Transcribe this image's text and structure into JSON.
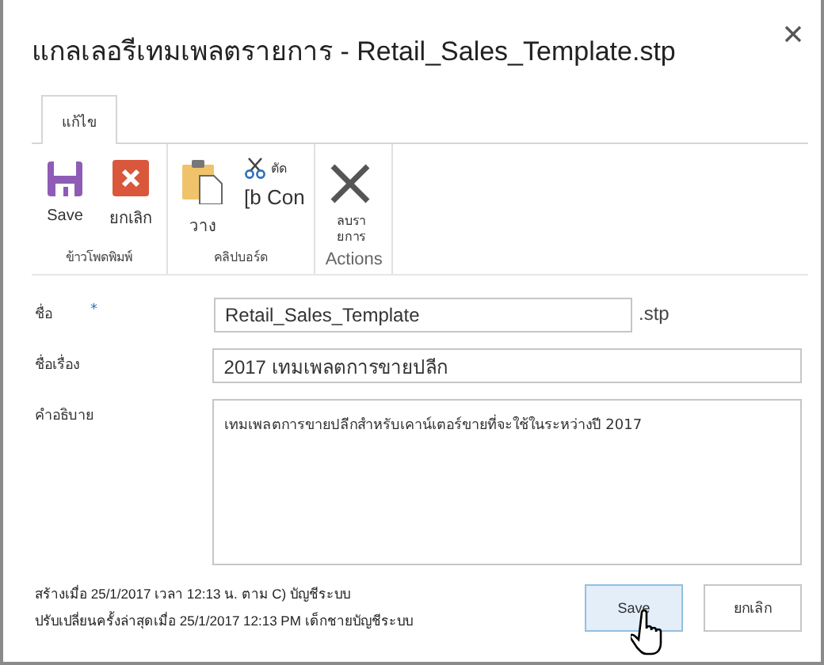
{
  "window": {
    "title": "แกลเลอรีเทมเพลตรายการ - Retail_Sales_Template.stp"
  },
  "ribbon": {
    "tabs": [
      {
        "label": "แก้ไข",
        "selected": true
      }
    ],
    "groups": [
      {
        "label": "ข้าวโพดพิมพ์",
        "commands": [
          {
            "kind": "save",
            "label": "Save"
          },
          {
            "kind": "cancel",
            "label": "ยกเลิก"
          }
        ]
      },
      {
        "label": "คลิปบอร์ด",
        "commands": [
          {
            "kind": "paste",
            "label": "วาง"
          },
          {
            "kind": "cut",
            "label": "ตัด"
          },
          {
            "kind": "copy",
            "label": "[b Con"
          }
        ]
      },
      {
        "label": "Actions",
        "commands": [
          {
            "kind": "delete",
            "label": "ลบรา ยการ"
          }
        ]
      }
    ]
  },
  "fields": [
    {
      "kind": "input",
      "label": "ชื่อ",
      "required_mark": "*",
      "value": "Retail_Sales_Template",
      "suffix": ".stp"
    },
    {
      "kind": "input",
      "label": "ชื่อเรื่อง",
      "value": "2017 เทมเพลตการขายปลีก"
    },
    {
      "kind": "textarea",
      "label": "คำอธิบาย",
      "value": "เทมเพลตการขายปลีกสำหรับเคาน์เตอร์ขายที่จะใช้ในระหว่างปี 2017"
    }
  ],
  "footer": {
    "created": "สร้างเมื่อ 25/1/2017 เวลา 12:13 น. ตาม C) บัญชีระบบ",
    "modified": "ปรับเปลี่ยนครั้งล่าสุดเมื่อ 25/1/2017 12:13 PM เด็กชายบัญชีระบบ"
  },
  "buttons": [
    {
      "label": "Save",
      "hovered": true
    },
    {
      "label": "ยกเลิก",
      "hovered": false
    }
  ]
}
